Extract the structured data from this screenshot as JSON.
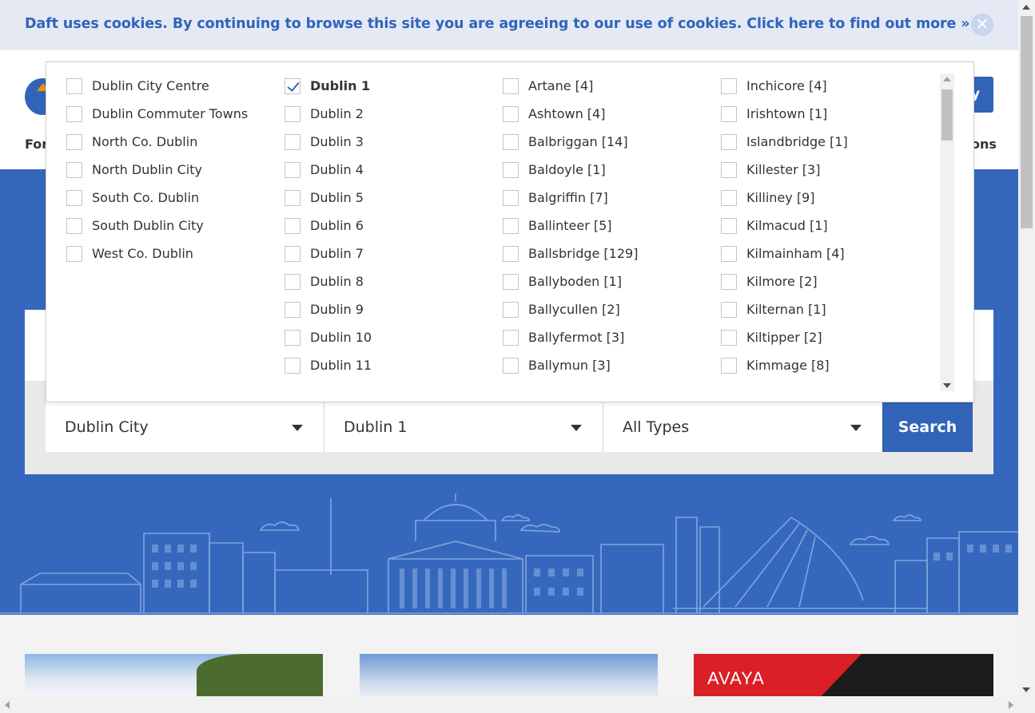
{
  "cookie": {
    "text": "Daft uses cookies. By continuing to browse this site you are agreeing to our use of cookies. Click here to find out more »",
    "close_glyph": "✕"
  },
  "header": {
    "nav_left_fragment": "For",
    "nav_right_fragment": "ons",
    "button_fragment": "y"
  },
  "search": {
    "area_value": "Dublin City",
    "location_value": "Dublin 1",
    "type_value": "All Types",
    "button_label": "Search"
  },
  "dropdown": {
    "columns": [
      [
        {
          "label": "Dublin City Centre",
          "checked": false
        },
        {
          "label": "Dublin Commuter Towns",
          "checked": false
        },
        {
          "label": "North Co. Dublin",
          "checked": false
        },
        {
          "label": "North Dublin City",
          "checked": false
        },
        {
          "label": "South Co. Dublin",
          "checked": false
        },
        {
          "label": "South Dublin City",
          "checked": false
        },
        {
          "label": "West Co. Dublin",
          "checked": false
        }
      ],
      [
        {
          "label": "Dublin 1",
          "checked": true
        },
        {
          "label": "Dublin 2",
          "checked": false
        },
        {
          "label": "Dublin 3",
          "checked": false
        },
        {
          "label": "Dublin 4",
          "checked": false
        },
        {
          "label": "Dublin 5",
          "checked": false
        },
        {
          "label": "Dublin 6",
          "checked": false
        },
        {
          "label": "Dublin 7",
          "checked": false
        },
        {
          "label": "Dublin 8",
          "checked": false
        },
        {
          "label": "Dublin 9",
          "checked": false
        },
        {
          "label": "Dublin 10",
          "checked": false
        },
        {
          "label": "Dublin 11",
          "checked": false
        }
      ],
      [
        {
          "label": "Artane [4]",
          "checked": false
        },
        {
          "label": "Ashtown [4]",
          "checked": false
        },
        {
          "label": "Balbriggan [14]",
          "checked": false
        },
        {
          "label": "Baldoyle [1]",
          "checked": false
        },
        {
          "label": "Balgriffin [7]",
          "checked": false
        },
        {
          "label": "Ballinteer [5]",
          "checked": false
        },
        {
          "label": "Ballsbridge [129]",
          "checked": false
        },
        {
          "label": "Ballyboden [1]",
          "checked": false
        },
        {
          "label": "Ballycullen [2]",
          "checked": false
        },
        {
          "label": "Ballyfermot [3]",
          "checked": false
        },
        {
          "label": "Ballymun [3]",
          "checked": false
        }
      ],
      [
        {
          "label": "Inchicore [4]",
          "checked": false
        },
        {
          "label": "Irishtown [1]",
          "checked": false
        },
        {
          "label": "Islandbridge [1]",
          "checked": false
        },
        {
          "label": "Killester [3]",
          "checked": false
        },
        {
          "label": "Killiney [9]",
          "checked": false
        },
        {
          "label": "Kilmacud [1]",
          "checked": false
        },
        {
          "label": "Kilmainham [4]",
          "checked": false
        },
        {
          "label": "Kilmore [2]",
          "checked": false
        },
        {
          "label": "Kilternan [1]",
          "checked": false
        },
        {
          "label": "Kiltipper [2]",
          "checked": false
        },
        {
          "label": "Kimmage [8]",
          "checked": false
        }
      ]
    ]
  },
  "cards": {
    "ad_brand": "AVAYA"
  },
  "colors": {
    "brand_blue": "#3164b9",
    "hero_blue": "#3568bd",
    "logo_orange": "#f39200",
    "ad_red": "#da1f26"
  }
}
